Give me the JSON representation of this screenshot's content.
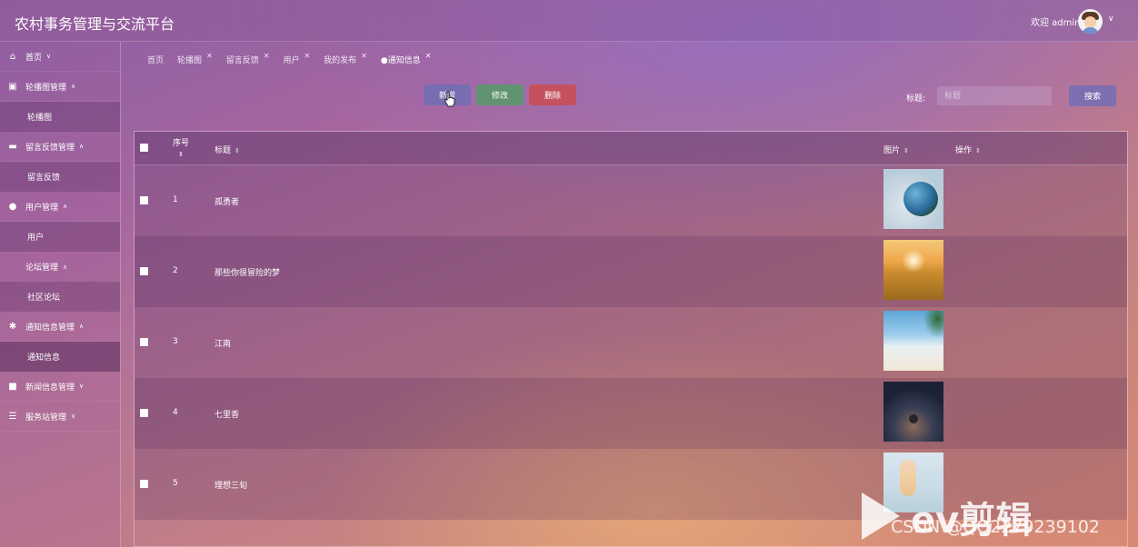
{
  "header": {
    "title": "农村事务管理与交流平台",
    "welcome": "欢迎 admin"
  },
  "sidebar": {
    "items": [
      {
        "icon": "home-icon",
        "label": "首页",
        "caret": "down"
      },
      {
        "icon": "carousel-icon",
        "label": "轮播图管理",
        "caret": "up",
        "children": [
          "轮播图"
        ]
      },
      {
        "icon": "feedback-icon",
        "label": "留言反馈管理",
        "caret": "up",
        "children": [
          "留言反馈"
        ]
      },
      {
        "icon": "user-icon",
        "label": "用户管理",
        "caret": "up",
        "children": [
          "用户"
        ]
      },
      {
        "icon": "",
        "label": "论坛管理",
        "caret": "up",
        "children": [
          "社区论坛"
        ]
      },
      {
        "icon": "notice-icon",
        "label": "通知信息管理",
        "caret": "up",
        "children": [
          "通知信息"
        ]
      },
      {
        "icon": "news-icon",
        "label": "新闻信息管理",
        "caret": "down"
      },
      {
        "icon": "station-icon",
        "label": "服务站管理",
        "caret": "down"
      }
    ]
  },
  "tabs": [
    {
      "label": "首页",
      "closable": false
    },
    {
      "label": "轮播图",
      "closable": true
    },
    {
      "label": "留言反馈",
      "closable": true
    },
    {
      "label": "用户",
      "closable": true
    },
    {
      "label": "我的发布",
      "closable": true
    },
    {
      "label": "●通知信息",
      "closable": true
    }
  ],
  "toolbar": {
    "add_label": "新增",
    "edit_label": "修改",
    "delete_label": "删除",
    "search_label": "标题:",
    "search_placeholder": "标题",
    "search_button": "搜索"
  },
  "table": {
    "columns": [
      "序号",
      "标题",
      "图片",
      "操作"
    ],
    "rows": [
      {
        "index": "1",
        "title": "孤勇者",
        "image": "earth"
      },
      {
        "index": "2",
        "title": "那些你很冒险的梦",
        "image": "wheat"
      },
      {
        "index": "3",
        "title": "江南",
        "image": "beach"
      },
      {
        "index": "4",
        "title": "七里香",
        "image": "tree"
      },
      {
        "index": "5",
        "title": "理想三旬",
        "image": "girl"
      }
    ]
  },
  "watermark": {
    "brand": "ev剪辑",
    "csdn": "CSDN @QQ2279239102"
  },
  "colors": {
    "add": "#736eb4",
    "edit": "#5f966e",
    "delete": "#c8505a"
  }
}
